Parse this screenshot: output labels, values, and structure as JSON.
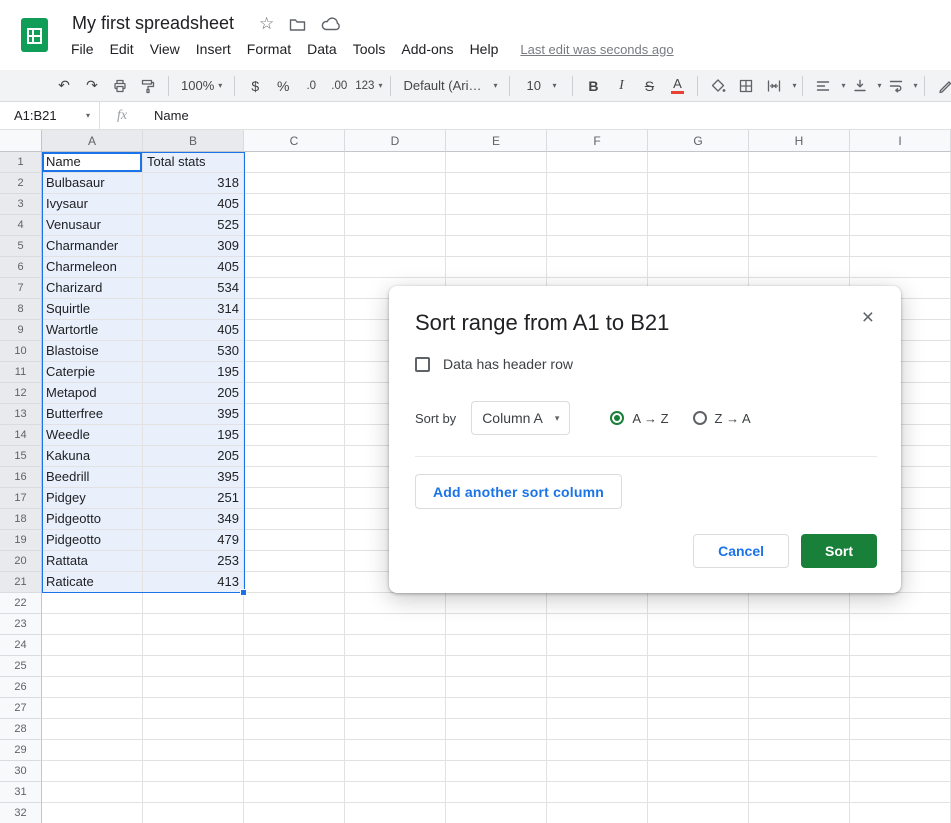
{
  "header": {
    "title": "My first spreadsheet",
    "menus": [
      "File",
      "Edit",
      "View",
      "Insert",
      "Format",
      "Data",
      "Tools",
      "Add-ons",
      "Help"
    ],
    "last_edit": "Last edit was seconds ago"
  },
  "toolbar": {
    "zoom": "100%",
    "currency": "$",
    "percent": "%",
    "decrease_decimal": ".0",
    "increase_decimal": ".00",
    "more_formats": "123",
    "font_name": "Default (Ari…",
    "font_size": "10",
    "bold": "B",
    "italic": "I",
    "strikethrough": "S",
    "text_color": "A"
  },
  "formula_bar": {
    "name_box": "A1:B21",
    "fx_label": "fx",
    "content": "Name"
  },
  "grid": {
    "columns": [
      "A",
      "B",
      "C",
      "D",
      "E",
      "F",
      "G",
      "H",
      "I"
    ],
    "row_count": 32,
    "selected_columns": [
      "A",
      "B"
    ],
    "selected_rows_end": 21,
    "cells": [
      [
        "Name",
        "Total stats"
      ],
      [
        "Bulbasaur",
        318
      ],
      [
        "Ivysaur",
        405
      ],
      [
        "Venusaur",
        525
      ],
      [
        "Charmander",
        309
      ],
      [
        "Charmeleon",
        405
      ],
      [
        "Charizard",
        534
      ],
      [
        "Squirtle",
        314
      ],
      [
        "Wartortle",
        405
      ],
      [
        "Blastoise",
        530
      ],
      [
        "Caterpie",
        195
      ],
      [
        "Metapod",
        205
      ],
      [
        "Butterfree",
        395
      ],
      [
        "Weedle",
        195
      ],
      [
        "Kakuna",
        205
      ],
      [
        "Beedrill",
        395
      ],
      [
        "Pidgey",
        251
      ],
      [
        "Pidgeotto",
        349
      ],
      [
        "Pidgeotto",
        479
      ],
      [
        "Rattata",
        253
      ],
      [
        "Raticate",
        413
      ]
    ]
  },
  "dialog": {
    "title": "Sort range from A1 to B21",
    "close_label": "×",
    "header_row_checkbox": "Data has header row",
    "sort_by": "Sort by",
    "column_value": "Column A",
    "asc_label": "A → Z",
    "desc_label": "Z → A",
    "add_sort_column": "Add another sort column",
    "cancel": "Cancel",
    "sort": "Sort"
  },
  "colors": {
    "brand_green": "#0f9d58",
    "button_green": "#188038",
    "link_blue": "#1a73e8",
    "selection_blue": "#1a73e8"
  }
}
